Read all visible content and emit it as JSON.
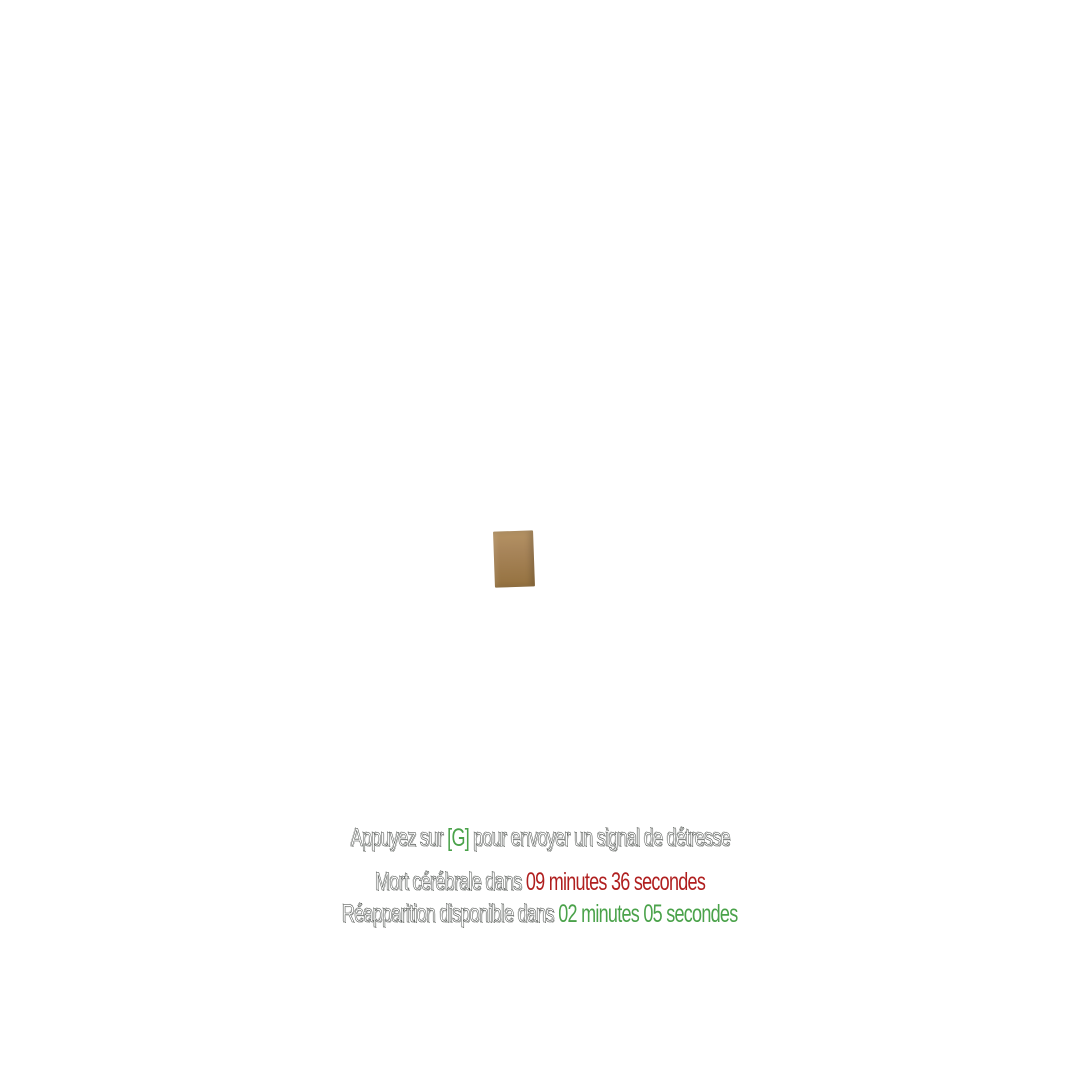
{
  "hud": {
    "distress": {
      "prefix": "Appuyez sur",
      "key": "[G]",
      "suffix": "pour envoyer un signal de détresse"
    },
    "brain_death": {
      "label": "Mort cérébrale dans",
      "countdown": "09 minutes 36 secondes"
    },
    "respawn": {
      "label": "Réapparition disponible dans",
      "countdown": "02 minutes 05 secondes"
    }
  },
  "colors": {
    "background": "#ffffff",
    "key_highlight": "#4aa24a",
    "danger": "#b01f1f",
    "available": "#4aa24a",
    "text_outline": "#3b3f3b"
  }
}
